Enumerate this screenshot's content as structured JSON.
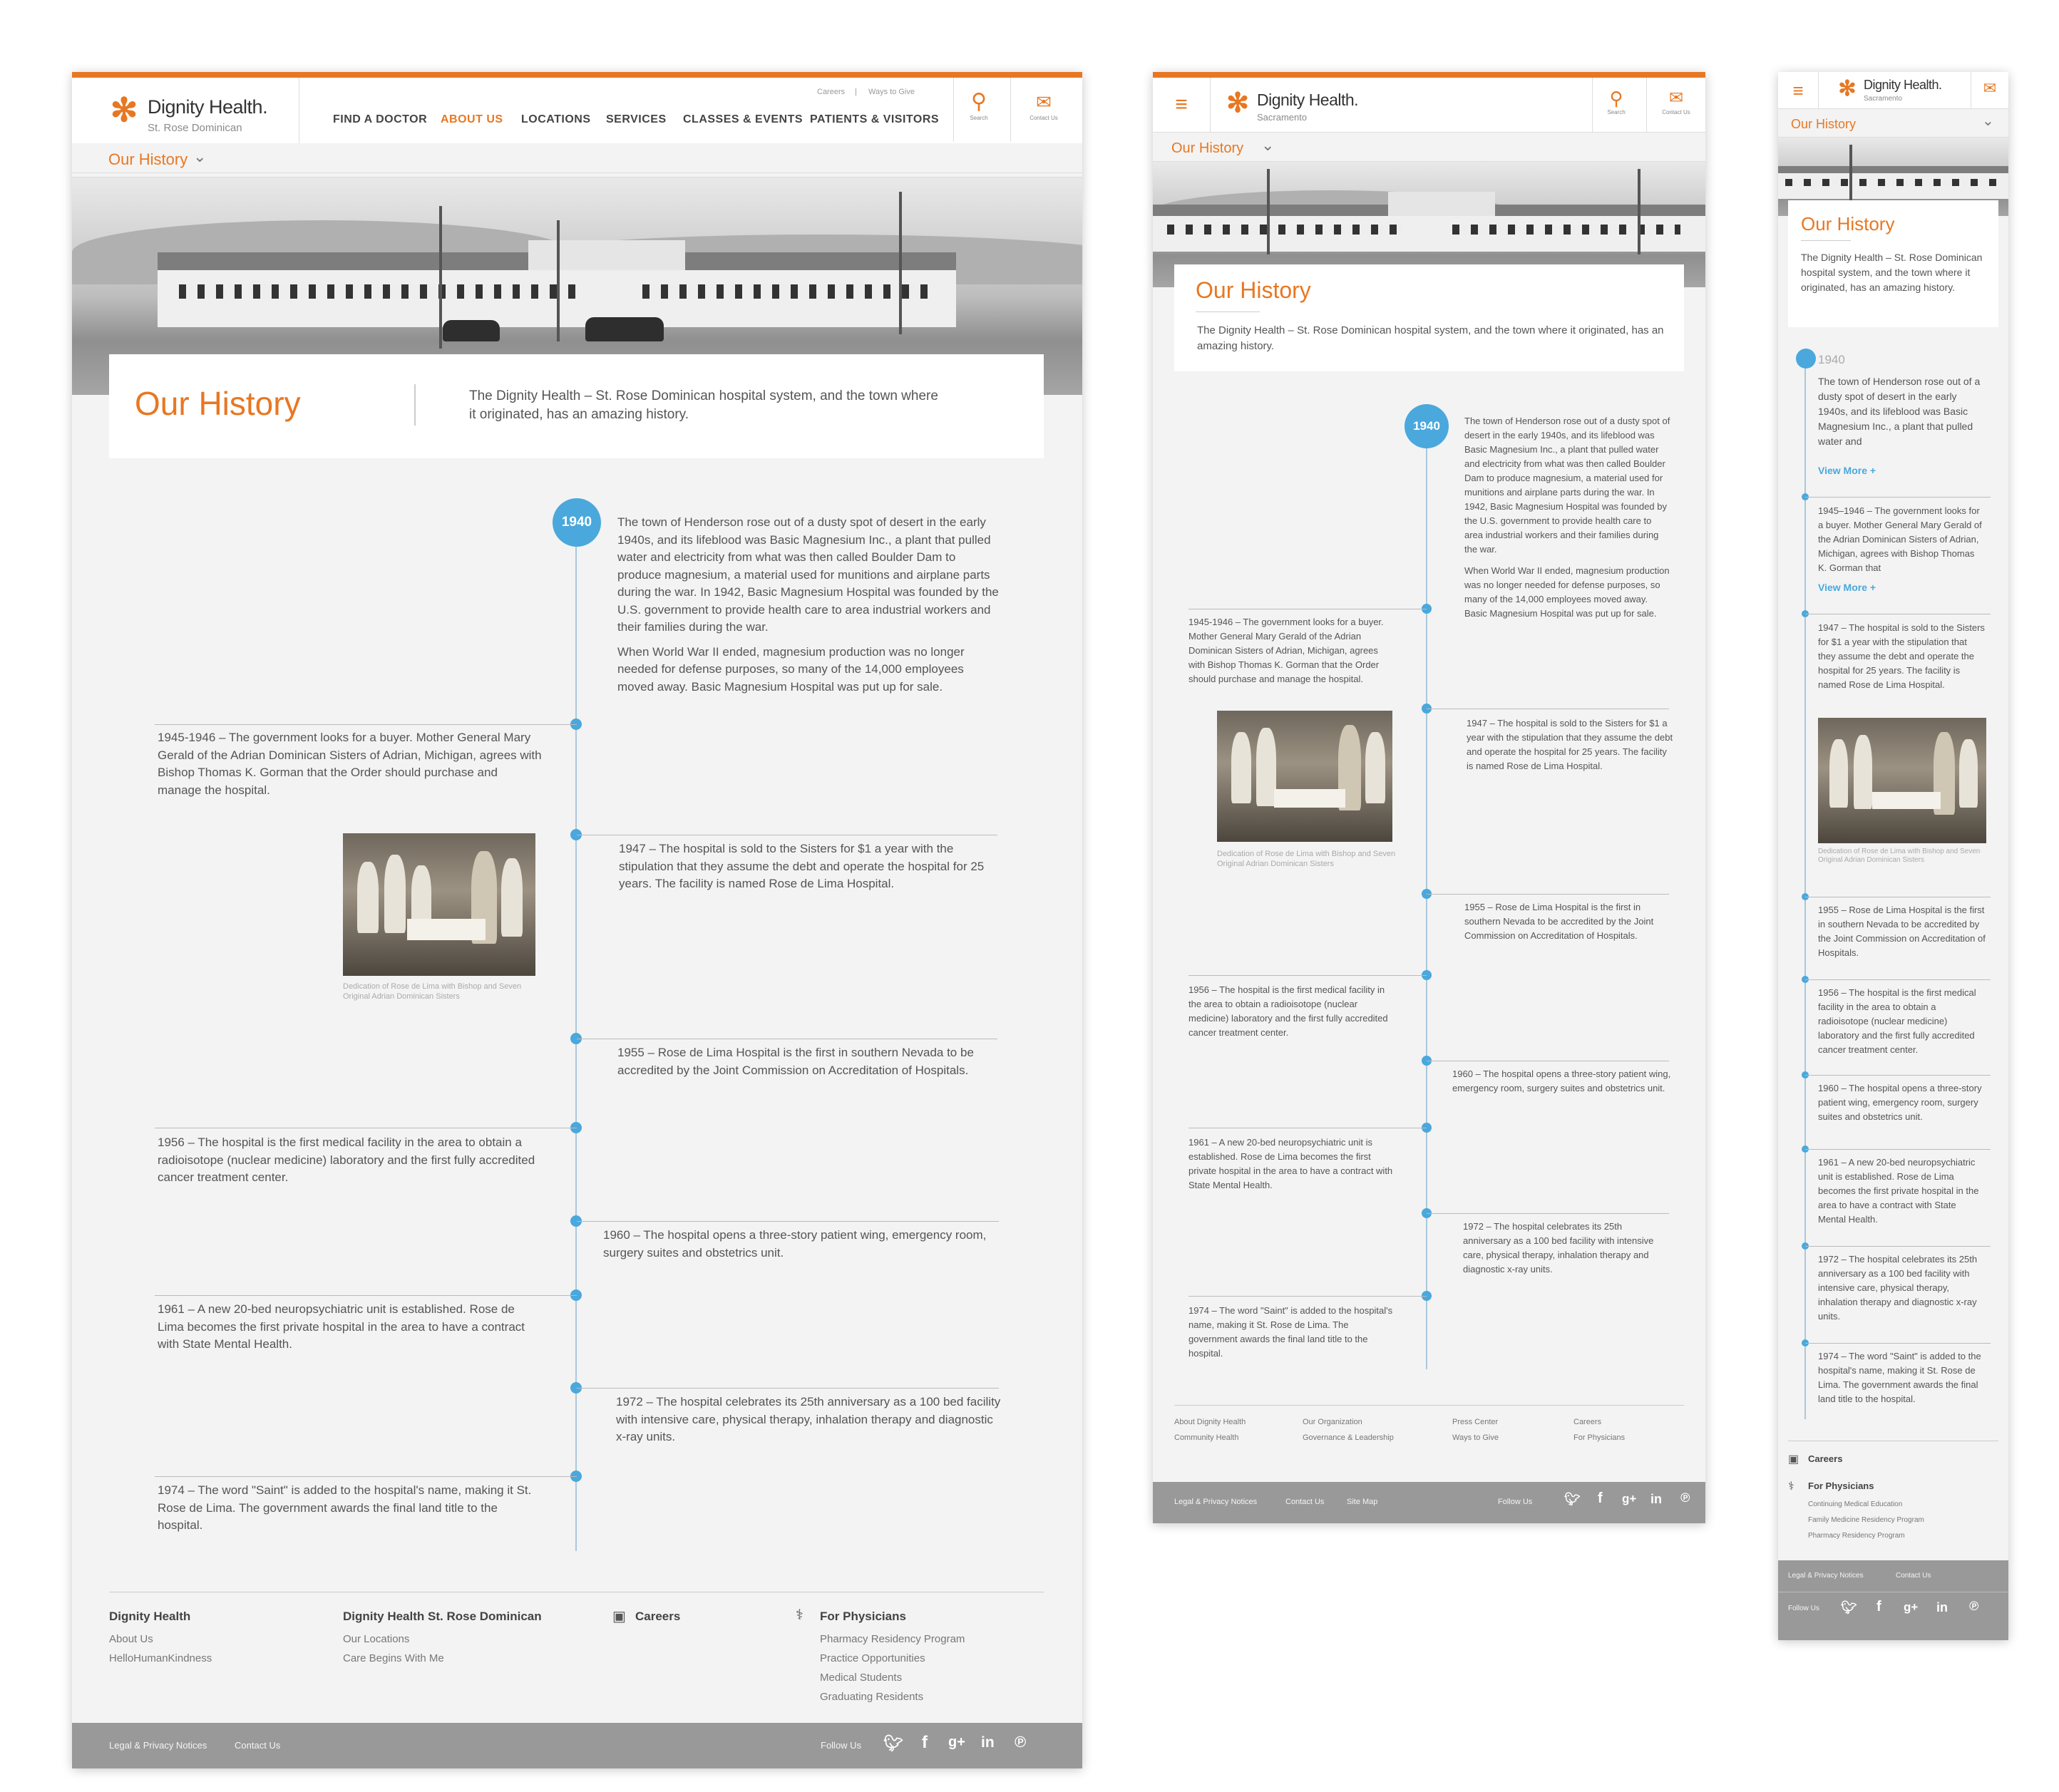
{
  "brand": {
    "name": "Dignity Health.",
    "desktop_sub": "St. Rose Dominican",
    "tablet_sub": "Sacramento",
    "mobile_sub": "Sacramento",
    "accent": "#e87722",
    "timeline_blue": "#4aa8dc"
  },
  "nav": {
    "utility": [
      "Careers",
      "Ways to Give"
    ],
    "items": [
      "FIND A DOCTOR",
      "ABOUT US",
      "LOCATIONS",
      "SERVICES",
      "CLASSES & EVENTS",
      "PATIENTS & VISITORS"
    ],
    "active": "ABOUT US",
    "search_label": "Search",
    "contact_label": "Contact Us"
  },
  "subnav": {
    "label": "Our History"
  },
  "intro": {
    "title": "Our History",
    "desktop_text": "The Dignity Health – St. Rose Dominican hospital system, and the town where it originated, has an amazing history.",
    "tablet_text": "The Dignity Health – St. Rose Dominican hospital system, and the town where it originated, has an amazing history.",
    "mobile_text": "The Dignity Health – St. Rose Dominican hospital system, and the town where it originated, has an amazing history."
  },
  "timeline": {
    "year": "1940",
    "e1940_p1": "The town of Henderson rose out of a dusty spot of desert in the early 1940s, and its lifeblood was Basic Magnesium Inc., a plant that pulled water and electricity from what was then called Boulder Dam to produce magnesium, a material used for munitions and airplane parts during the war. In 1942, Basic Magnesium Hospital was founded by the U.S. government to provide health care to area industrial workers and their families during the war.",
    "e1940_p2": "When World War II ended, magnesium production was no longer needed for defense purposes, so many of the 14,000 employees moved away. Basic Magnesium Hospital was put up for sale.",
    "e1945": "1945-1946 – The government looks for a buyer. Mother General Mary Gerald of the Adrian Dominican Sisters of Adrian, Michigan, agrees with Bishop Thomas K. Gorman that the Order should purchase and manage the hospital.",
    "e1947": "1947 – The hospital is sold to the Sisters for $1 a year with the stipulation that they assume the debt and operate the hospital for 25 years. The facility is named Rose de Lima Hospital.",
    "photo_caption": "Dedication of Rose de Lima with Bishop and Seven Original Adrian Dominican Sisters",
    "e1955": "1955 – Rose de Lima Hospital is the first in southern Nevada to be accredited by the Joint Commission on Accreditation of Hospitals.",
    "e1956": "1956 – The hospital is the first medical facility in the area to obtain a radioisotope (nuclear medicine) laboratory and the first fully accredited cancer treatment center.",
    "e1960": "1960 – The hospital opens a three-story patient wing, emergency room, surgery suites and obstetrics unit.",
    "e1961": "1961 – A new 20-bed neuropsychiatric unit is established. Rose de Lima becomes the first private hospital in the area to have a contract with State Mental Health.",
    "e1972": "1972 – The hospital celebrates its 25th anniversary as a 100 bed facility with intensive care, physical therapy, inhalation therapy and diagnostic x-ray units.",
    "e1974": "1974 – The word \"Saint\" is added to the hospital's name, making it St. Rose de Lima. The government awards the final land title to the hospital.",
    "mobile_1940": "The town of Henderson rose out of a dusty spot of desert in the early 1940s, and its lifeblood was Basic Magnesium Inc., a plant that pulled water and",
    "mobile_1945": "1945–1946 – The government looks for a buyer. Mother General Mary Gerald of the Adrian Dominican Sisters of Adrian, Michigan, agrees with Bishop Thomas K. Gorman that",
    "view_more": "View More +"
  },
  "footer": {
    "col1_title": "Dignity Health",
    "col1_links": [
      "About Us",
      "HelloHumanKindness"
    ],
    "col2_title": "Dignity Health St. Rose Dominican",
    "col2_links": [
      "Our Locations",
      "Care Begins With Me"
    ],
    "col3_title": "Careers",
    "col4_title": "For Physicians",
    "col4_links": [
      "Pharmacy Residency Program",
      "Practice Opportunities",
      "Medical Students",
      "Graduating Residents"
    ],
    "tablet_links": [
      "About Dignity Health",
      "Community Health",
      "Our Organization",
      "Governance & Leadership",
      "Press Center",
      "Ways to Give",
      "Careers",
      "For Physicians"
    ],
    "mobile_careers": "Careers",
    "mobile_physicians": "For Physicians",
    "mobile_links": [
      "Continuing Medical Education",
      "Family Medicine Residency Program",
      "Pharmacy Residency Program"
    ],
    "legal": "Legal & Privacy Notices",
    "contact": "Contact Us",
    "sitemap": "Site Map",
    "follow": "Follow Us",
    "social_icons": [
      "twitter-icon",
      "facebook-icon",
      "google-plus-icon",
      "linkedin-icon",
      "pinterest-icon"
    ]
  }
}
